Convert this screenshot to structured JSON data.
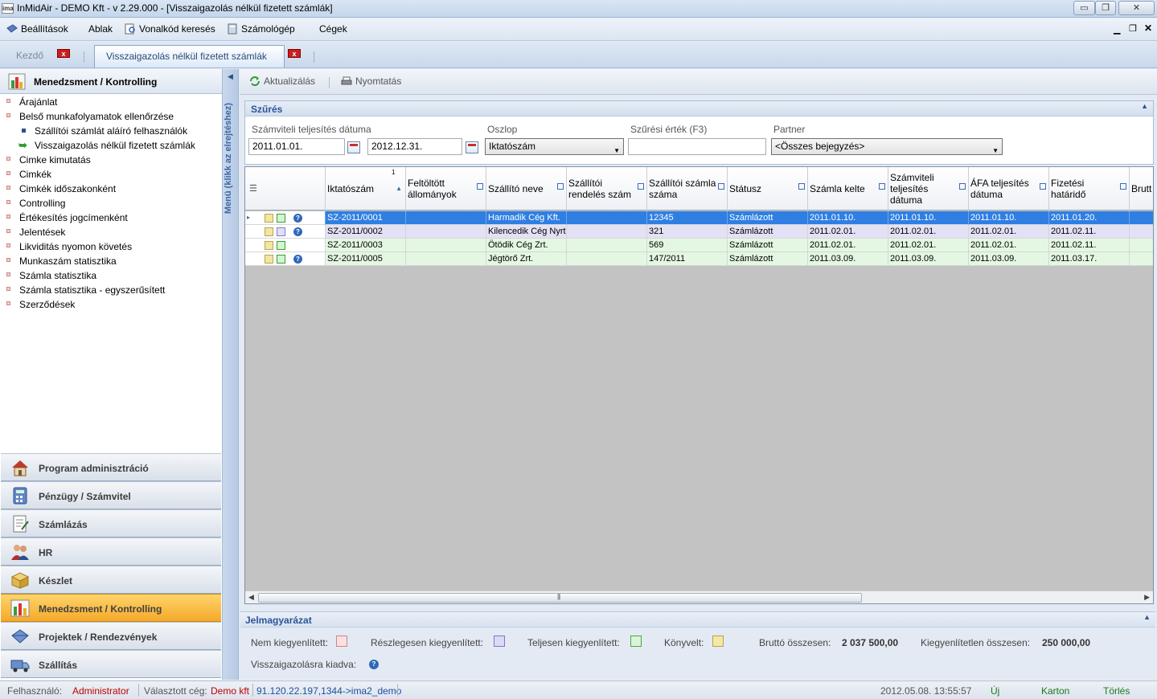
{
  "window": {
    "logo_text": "ima",
    "title": "InMidAir - DEMO Kft - v 2.29.000 - [Visszaigazolás nélkül fizetett számlák]",
    "min_glyph": "▭",
    "max_glyph": "❐",
    "close_glyph": "✕"
  },
  "menubar": {
    "items": [
      "Beállítások",
      "Ablak",
      "Vonalkód keresés",
      "Számológép",
      "Cégek"
    ],
    "mdi_min": "▁",
    "mdi_restore": "❐",
    "mdi_close": "✕"
  },
  "tabs": {
    "home_label": "Kezdő",
    "active_label": "Visszaigazolás nélkül fizetett számlák",
    "close_glyph": "x"
  },
  "sidebar": {
    "header": "Menedzsment / Kontrolling",
    "tree": [
      "Árajánlat",
      "Belső munkafolyamatok ellenőrzése",
      "Szállítói számlát aláíró felhasználók",
      "Visszaigazolás nélkül fizetett számlák",
      "Cimke kimutatás",
      "Cimkék",
      "Cimkék időszakonként",
      "Controlling",
      "Értékesítés jogcímenként",
      "Jelentések",
      "Likviditás nyomon követés",
      "Munkaszám statisztika",
      "Számla statisztika",
      "Számla statisztika - egyszerűsített",
      "Szerződések"
    ],
    "modules": [
      {
        "label": "Program adminisztráció",
        "icon": "home-icon"
      },
      {
        "label": "Pénzügy / Számvitel",
        "icon": "calculator-icon"
      },
      {
        "label": "Számlázás",
        "icon": "invoice-icon"
      },
      {
        "label": "HR",
        "icon": "people-icon"
      },
      {
        "label": "Készlet",
        "icon": "box-icon"
      },
      {
        "label": "Menedzsment / Kontrolling",
        "icon": "chart-icon"
      },
      {
        "label": "Projektek / Rendezvények",
        "icon": "diamond-icon"
      },
      {
        "label": "Szállítás",
        "icon": "truck-icon"
      }
    ],
    "rail_text": "Menü (klikk az elrejtéshez)",
    "rail_arrow": "◀"
  },
  "toolbar": {
    "refresh": "Aktualizálás",
    "print": "Nyomtatás"
  },
  "filter": {
    "title": "Szűrés",
    "collapse_glyph": "▲",
    "date_label": "Számviteli teljesítés dátuma",
    "date_from": "2011.01.01.",
    "date_to": "2012.12.31.",
    "column_label": "Oszlop",
    "column_value": "Iktatószám",
    "value_label": "Szűrési érték (F3)",
    "value": "",
    "partner_label": "Partner",
    "partner_value": "<Összes bejegyzés>",
    "dropdown_glyph": "▼"
  },
  "grid": {
    "group_glyph": "☰",
    "sort_number": "1",
    "sort_glyph": "▲",
    "columns": [
      "Iktatószám",
      "Feltöltött állományok",
      "Szállító neve",
      "Szállítói rendelés szám",
      "Szállítói számla száma",
      "Státusz",
      "Számla kelte",
      "Számviteli teljesítés dátuma",
      "ÁFA teljesítés dátuma",
      "Fizetési határidő",
      "Brutt"
    ],
    "rows": [
      {
        "marker": "▸",
        "status_color": "yellow-green-question",
        "iktato": "SZ-2011/0001",
        "files": "",
        "supplier": "Harmadik Cég Kft.",
        "order": "",
        "invoice_no": "12345",
        "status": "Számlázott",
        "issued": "2011.01.10.",
        "acc_date": "2011.01.10.",
        "vat_date": "2011.01.10.",
        "due": "2011.01.20.",
        "gross": ""
      },
      {
        "marker": "",
        "status_color": "yellow-lilac-question",
        "iktato": "SZ-2011/0002",
        "files": "",
        "supplier": "Kilencedik Cég Nyrt.",
        "order": "",
        "invoice_no": "321",
        "status": "Számlázott",
        "issued": "2011.02.01.",
        "acc_date": "2011.02.01.",
        "vat_date": "2011.02.01.",
        "due": "2011.02.11.",
        "gross": ""
      },
      {
        "marker": "",
        "status_color": "yellow-green",
        "iktato": "SZ-2011/0003",
        "files": "",
        "supplier": "Ötödik Cég Zrt.",
        "order": "",
        "invoice_no": "569",
        "status": "Számlázott",
        "issued": "2011.02.01.",
        "acc_date": "2011.02.01.",
        "vat_date": "2011.02.01.",
        "due": "2011.02.11.",
        "gross": ""
      },
      {
        "marker": "",
        "status_color": "yellow-green-question",
        "iktato": "SZ-2011/0005",
        "files": "",
        "supplier": "Jégtörő Zrt.",
        "order": "",
        "invoice_no": "147/2011",
        "status": "Számlázott",
        "issued": "2011.03.09.",
        "acc_date": "2011.03.09.",
        "vat_date": "2011.03.09.",
        "due": "2011.03.17.",
        "gross": ""
      }
    ],
    "scroll_left": "◀",
    "scroll_right": "▶",
    "scroll_grip": "|||"
  },
  "legend": {
    "title": "Jelmagyarázat",
    "collapse_glyph": "▲",
    "unpaid": "Nem kiegyenlített:",
    "partial": "Részlegesen kiegyenlített:",
    "paid": "Teljesen kiegyenlített:",
    "booked": "Könyvelt:",
    "gross_label": "Bruttó összesen:",
    "gross_value": "2 037 500,00",
    "unsettled_label": "Kiegyenlítetlen összesen:",
    "unsettled_value": "250 000,00",
    "sent_label": "Visszaigazolásra kiadva:",
    "colors": {
      "unpaid": "#fbe0e0",
      "partial": "#dcd9f5",
      "paid": "#d9f5d5",
      "booked": "#f4e8a6"
    }
  },
  "status": {
    "user_label": "Felhasználó:",
    "user": "Administrator",
    "company_label": "Választott cég:",
    "company": "Demo kft",
    "server": "91.120.22.197,1344->ima2_demo",
    "datetime": "2012.05.08. 13:55:57",
    "new": "Új",
    "card": "Karton",
    "delete": "Törlés"
  },
  "colors": {
    "accent": "#2b5596",
    "selected_row": "#2f7fe3",
    "active_module": "#f5a92a",
    "status_red": "#c00000",
    "status_green": "#1a7a1a",
    "status_blue": "#1f4fa0"
  }
}
